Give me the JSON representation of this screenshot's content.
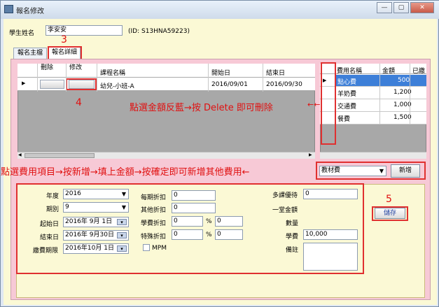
{
  "window": {
    "title": "報名修改",
    "minimize_label": "—",
    "maximize_label": "▢",
    "close_label": "✕"
  },
  "student": {
    "name_label": "學生姓名",
    "name_value": "李安安",
    "id_text": "(ID: S13HNA59223)"
  },
  "tabs": [
    {
      "label": "報名主檔"
    },
    {
      "label": "報名詳細"
    }
  ],
  "annotations": {
    "step3": "3",
    "step4": "4",
    "step5": "5",
    "fee_hint": "點選金額反藍→按 Delete 即可刪除",
    "fee_arrow": "←←",
    "add_hint": "點選費用項目→按新增→填上金額→按確定即可新增其他費用←"
  },
  "course_grid": {
    "headers": {
      "delete": "刪除",
      "edit": "修改",
      "course": "課程名稱",
      "start": "開始日",
      "end": "結束日"
    },
    "rows": [
      {
        "course": "幼兒-小班-A",
        "start": "2016/09/01",
        "end": "2016/09/30"
      }
    ]
  },
  "fee_grid": {
    "headers": {
      "name": "費用名稱",
      "amount": "金額",
      "paid": "已繳"
    },
    "rows": [
      {
        "name": "點心費",
        "amount": "500"
      },
      {
        "name": "羊奶費",
        "amount": "1,200"
      },
      {
        "name": "交通費",
        "amount": "1,000"
      },
      {
        "name": "餐費",
        "amount": "1,500"
      }
    ],
    "selected_index": 0
  },
  "fee_add": {
    "select_value": "教材費",
    "add_button": "新增"
  },
  "form": {
    "year_label": "年度",
    "year_value": "2016",
    "period_label": "期別",
    "period_value": "9",
    "start_label": "起始日",
    "start_value": "2016年 9月 1日",
    "end_label": "結束日",
    "end_value": "2016年 9月30日",
    "due_label": "繳費期限",
    "due_value": "2016年10月 1日",
    "period_discount_label": "每期折扣",
    "period_discount_value": "0",
    "other_discount_label": "其他折扣",
    "other_discount_value": "0",
    "tuition_discount_label": "學費折扣",
    "tuition_discount_value": "0",
    "tuition_discount_pct": "0",
    "special_discount_label": "特殊折扣",
    "special_discount_value": "0",
    "special_discount_pct": "0",
    "percent_sign": "%",
    "mpm_label": "MPM",
    "multi_course_label": "多課優待",
    "multi_course_value": "0",
    "total_label": "一堂金額",
    "quantity_label": "數量",
    "tuition_label": "學費",
    "tuition_value": "10,000",
    "note_label": "備註",
    "save_button": "儲存"
  }
}
